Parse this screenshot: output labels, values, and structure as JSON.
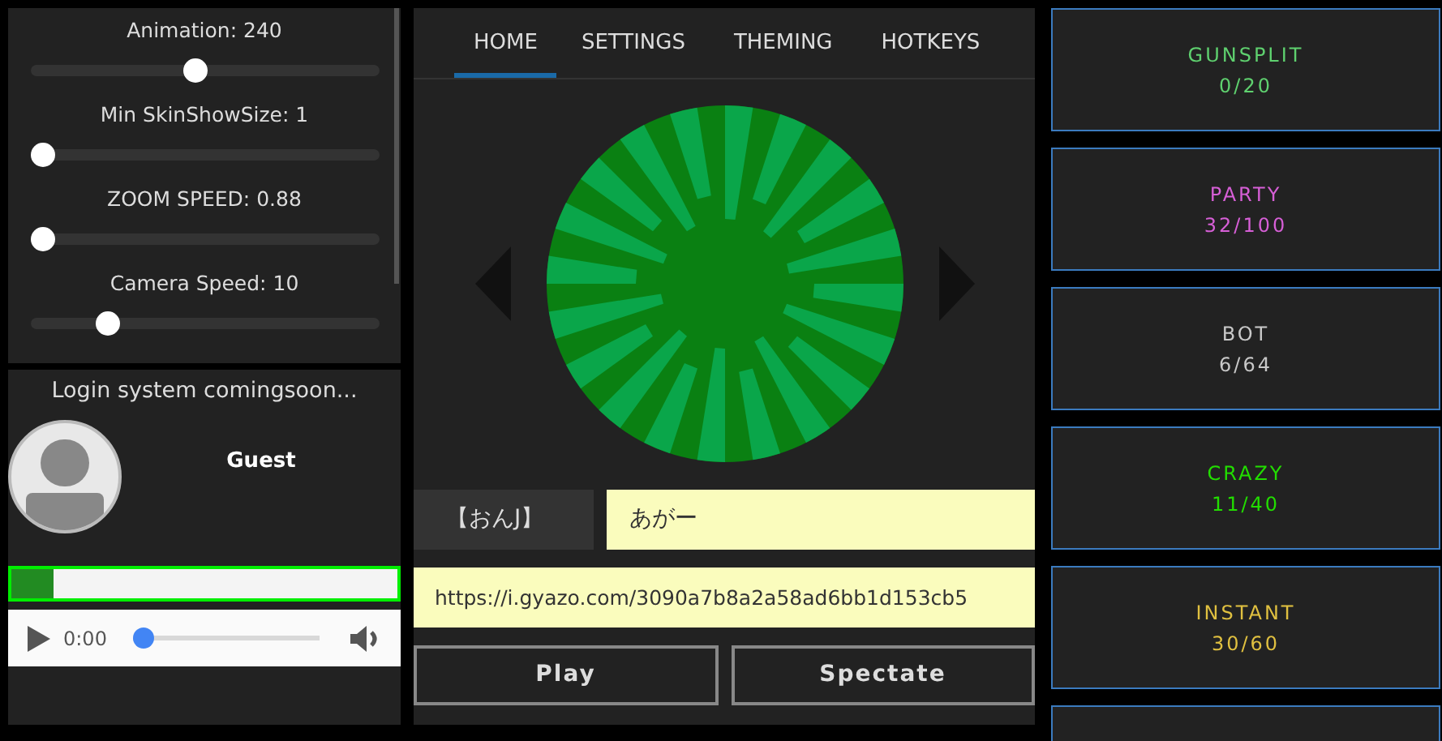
{
  "settings_sliders": [
    {
      "label": "Animation: 240",
      "level": 0.47
    },
    {
      "label": "Min SkinShowSize: 1",
      "level": 0
    },
    {
      "label": "ZOOM SPEED: 0.88",
      "level": 0
    },
    {
      "label": "Camera Speed: 10",
      "level": 0.2
    }
  ],
  "login": {
    "message": "Login system comingsoon...",
    "username": "Guest",
    "progress": {
      "level": 0.11
    }
  },
  "audio_player": {
    "time": "0:00",
    "level": 0
  },
  "tabs": [
    {
      "label": "HOME",
      "selected": true
    },
    {
      "label": "SETTINGS",
      "selected": false
    },
    {
      "label": "THEMING",
      "selected": false
    },
    {
      "label": "HOTKEYS",
      "selected": false
    }
  ],
  "tag": "【おんJ】",
  "nickname": {
    "value": "あがー"
  },
  "skin_url": {
    "value": "https://i.gyazo.com/3090a7b8a2a58ad6bb1d153cb5"
  },
  "buttons": [
    "Play",
    "Spectate"
  ],
  "servers": [
    {
      "name": "GUNSPLIT",
      "players": "0/20",
      "color": "#5fd16f"
    },
    {
      "name": "PARTY",
      "players": "32/100",
      "color": "#d65fd6"
    },
    {
      "name": "BOT",
      "players": "6/64",
      "color": "#c8c8c8"
    },
    {
      "name": "CRAZY",
      "players": "11/40",
      "color": "#22dd00"
    },
    {
      "name": "INSTANT",
      "players": "30/60",
      "color": "#e0c040"
    }
  ]
}
